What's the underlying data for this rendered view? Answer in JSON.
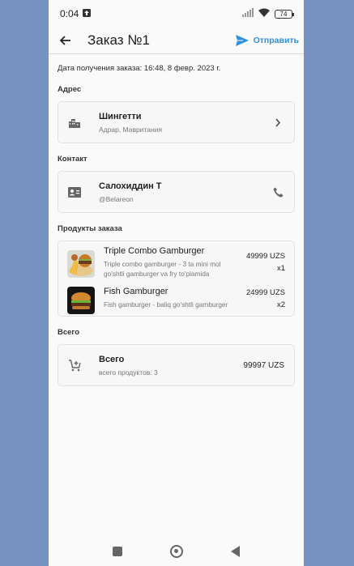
{
  "status_bar": {
    "time": "0:04",
    "battery": "74"
  },
  "header": {
    "title": "Заказ №1",
    "send_label": "Отправить"
  },
  "order": {
    "date_line": "Дата получения заказа: 16:48, 8 февр. 2023 г."
  },
  "address": {
    "section_label": "Адрес",
    "name": "Шингетти",
    "details": "Адрар, Мавритания"
  },
  "contact": {
    "section_label": "Контакт",
    "name": "Салохиддин Т",
    "handle": "@Belareon"
  },
  "products": {
    "section_label": "Продукты заказа",
    "items": [
      {
        "name": "Triple Combo Gamburger",
        "description": "Triple combo gamburger - 3 ta mini mol go'shtli gamburger va fry to'plamida",
        "price": "49999 UZS",
        "quantity": "x1"
      },
      {
        "name": "Fish Gamburger",
        "description": "Fish gamburger - baliq go'shtli gamburger",
        "price": "24999 UZS",
        "quantity": "x2"
      }
    ]
  },
  "total": {
    "section_label": "Всего",
    "title": "Всего",
    "count_line": "всего продуктов: 3",
    "amount": "99997 UZS"
  },
  "colors": {
    "accent": "#2d8fe0",
    "outer_background": "#7592c0",
    "card_background": "#f7f7f7"
  },
  "icons": [
    "arrow-back-icon",
    "send-icon",
    "city-icon",
    "chevron-right-icon",
    "contact-card-icon",
    "phone-icon",
    "cart-add-icon"
  ]
}
